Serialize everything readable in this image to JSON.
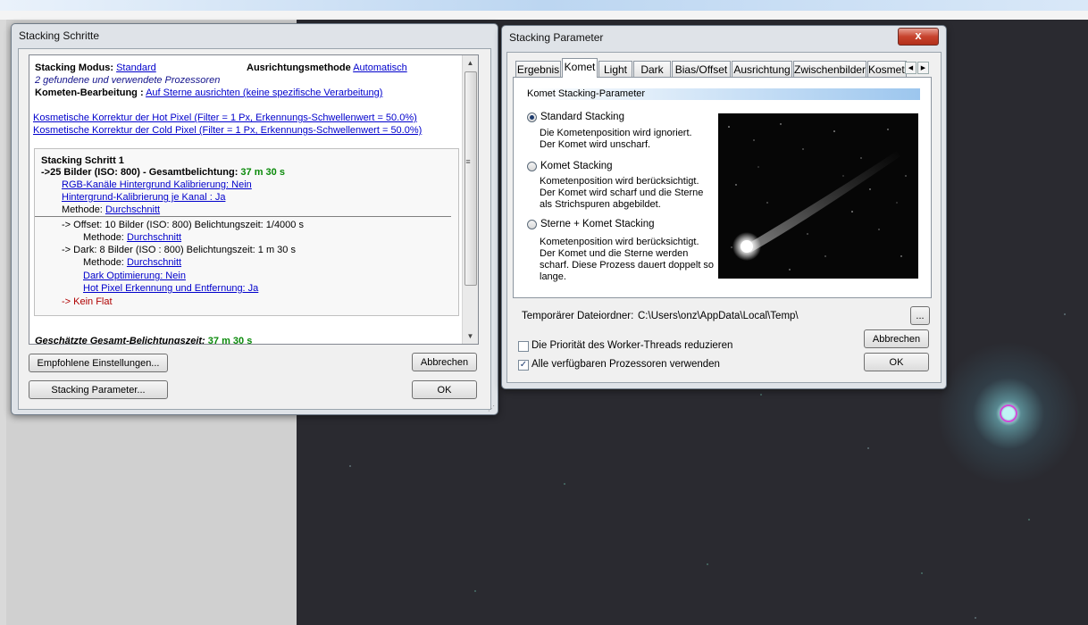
{
  "stacking_schritte": {
    "title": "Stacking Schritte",
    "modus_label": "Stacking Modus:",
    "modus_value": "Standard",
    "ausrichtung_label": "Ausrichtungsmethode",
    "ausrichtung_value": "Automatisch",
    "processors_note": "2 gefundene und verwendete Prozessoren",
    "kometen_label": "Kometen-Bearbeitung :",
    "kometen_value": "Auf Sterne ausrichten (keine spezifische Verarbeitung)",
    "hot_pixel_link": "Kosmetische Korrektur der Hot Pixel (Filter = 1 Px, Erkennungs-Schwellenwert = 50.0%)",
    "cold_pixel_link": "Kosmetische Korrektur der Cold Pixel (Filter = 1 Px, Erkennungs-Schwellenwert = 50.0%)",
    "step": {
      "title": "Stacking Schritt 1",
      "summary_prefix": "->25 Bilder (ISO: 800) - Gesamtbelichtung:",
      "summary_time": "37 m 30 s",
      "rgb_link": "RGB-Kanäle Hintergrund Kalibrierung: Nein",
      "bg_link": "Hintergrund-Kalibrierung je Kanal : Ja",
      "methode_label": "Methode:",
      "methode_value": "Durchschnitt",
      "offset_line": "-> Offset: 10 Bilder (ISO: 800) Belichtungszeit: 1/4000 s",
      "offset_methode_label": "Methode:",
      "offset_methode_value": "Durchschnitt",
      "dark_line": "-> Dark: 8 Bilder (ISO : 800) Belichtungszeit: 1 m 30 s",
      "dark_methode_label": "Methode:",
      "dark_methode_value": "Durchschnitt",
      "dark_opt_link": "Dark Optimierung: Nein",
      "hot_pixel_detect_link": "Hot Pixel Erkennung und Entfernung: Ja",
      "kein_flat": "-> Kein Flat"
    },
    "geschaetzte_label": "Geschätzte Gesamt-Belichtungszeit:",
    "geschaetzte_value": "37 m 30 s",
    "buttons": {
      "empfohlene": "Empfohlene Einstellungen...",
      "stacking_parameter": "Stacking Parameter...",
      "abbrechen": "Abbrechen",
      "ok": "OK"
    }
  },
  "stacking_parameter": {
    "title": "Stacking Parameter",
    "close": "x",
    "tabs": [
      "Ergebnis",
      "Komet",
      "Light",
      "Dark",
      "Bias/Offset",
      "Ausrichtung",
      "Zwischenbilder",
      "Kosmeti"
    ],
    "active_tab": "Komet",
    "section_title": "Komet Stacking-Parameter",
    "options": [
      {
        "label": "Standard Stacking",
        "selected": true,
        "desc": "Die Kometenposition wird ignoriert.\nDer Komet wird unscharf."
      },
      {
        "label": "Komet Stacking",
        "selected": false,
        "desc": "Kometenposition wird berücksichtigt.\nDer Komet wird scharf und die Sterne\nals Strichspuren abgebildet."
      },
      {
        "label": "Sterne + Komet Stacking",
        "selected": false,
        "desc": "Kometenposition wird berücksichtigt.\nDer Komet und die Sterne werden\nscharf. Diese Prozess dauert doppelt so\nlange."
      }
    ],
    "temp_label": "Temporärer Dateiordner:",
    "temp_value": "C:\\Users\\onz\\AppData\\Local\\Temp\\",
    "browse": "...",
    "prio_checkbox": {
      "label": "Die Priorität des Worker-Threads reduzieren",
      "checked": false
    },
    "all_proc_checkbox": {
      "label": "Alle verfügbaren Prozessoren verwenden",
      "checked": true
    },
    "buttons": {
      "abbrechen": "Abbrechen",
      "ok": "OK"
    }
  },
  "colors": {
    "accent_link": "#0000cc",
    "green_time": "#0a8a0a",
    "close_red": "#c7432d",
    "target_circle": "#d04bd8"
  }
}
